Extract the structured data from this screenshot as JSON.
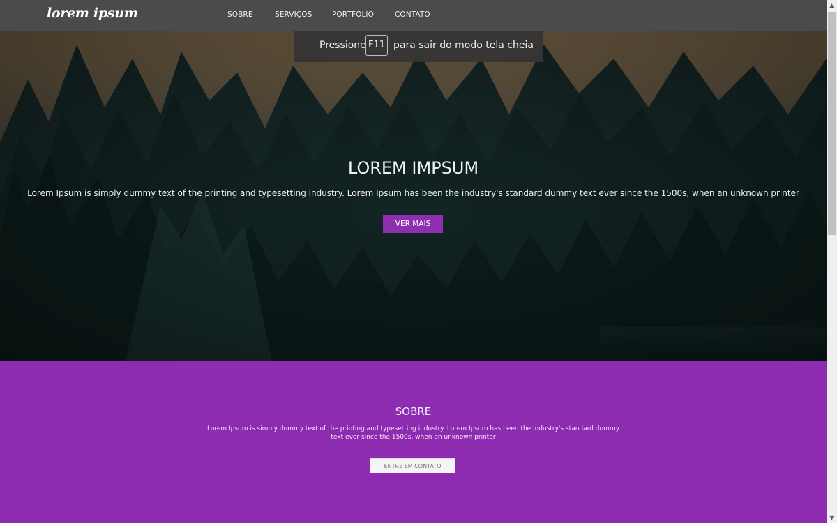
{
  "navbar": {
    "logo": "lorem ipsum",
    "links": [
      "SOBRE",
      "SERVIÇOS",
      "PORTFÓLIO",
      "CONTATO"
    ]
  },
  "fullscreen_notice": {
    "prefix": "Pressione",
    "key": "F11",
    "suffix": "para sair do modo tela cheia"
  },
  "hero": {
    "title": "LOREM IMPSUM",
    "text": "Lorem Ipsum is simply dummy text of the printing and typesetting industry. Lorem Ipsum has been the industry's standard dummy text ever since the 1500s, when an unknown printer",
    "button": "VER MAIS"
  },
  "about": {
    "title": "SOBRE",
    "text": "Lorem Ipsum is simply dummy text of the printing and typesetting industry. Lorem Ipsum has been the industry's standard dummy text ever since the 1500s, when an unknown printer",
    "button": "ENTRE EM CONTATO"
  },
  "colors": {
    "navbar": "#4b4b4b",
    "accent_purple": "#8d2cb0",
    "forest_dark": "#0c1a1c",
    "sky_warm": "#d8a96a"
  },
  "scrollbar": {
    "up_icon": "arrow-up-icon",
    "down_icon": "arrow-down-icon"
  }
}
